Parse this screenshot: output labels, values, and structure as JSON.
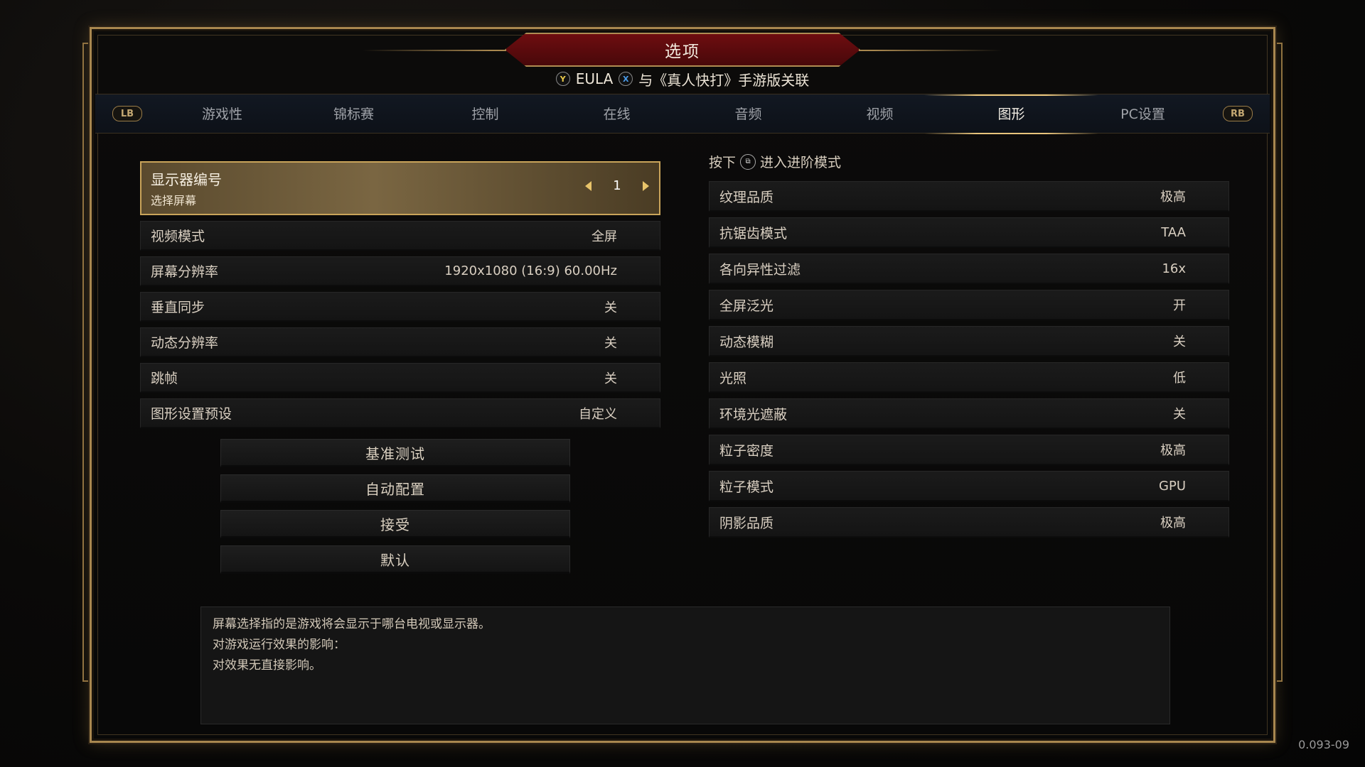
{
  "header": {
    "title": "选项",
    "eula_button": "Y",
    "eula_label": "EULA",
    "link_button": "X",
    "link_label": "与《真人快打》手游版关联"
  },
  "tabs": {
    "left_bumper": "LB",
    "right_bumper": "RB",
    "items": [
      {
        "label": "游戏性"
      },
      {
        "label": "锦标赛"
      },
      {
        "label": "控制"
      },
      {
        "label": "在线"
      },
      {
        "label": "音频"
      },
      {
        "label": "视频"
      },
      {
        "label": "图形",
        "active": true
      },
      {
        "label": "PC设置"
      }
    ]
  },
  "left_settings": {
    "selected": {
      "label": "显示器编号",
      "sublabel": "选择屏幕",
      "value": "1"
    },
    "rows": [
      {
        "label": "视频模式",
        "value": "全屏"
      },
      {
        "label": "屏幕分辨率",
        "value": "1920x1080 (16:9) 60.00Hz"
      },
      {
        "label": "垂直同步",
        "value": "关"
      },
      {
        "label": "动态分辨率",
        "value": "关"
      },
      {
        "label": "跳帧",
        "value": "关"
      },
      {
        "label": "图形设置预设",
        "value": "自定义"
      }
    ]
  },
  "action_buttons": [
    "基准测试",
    "自动配置",
    "接受",
    "默认"
  ],
  "advanced_hint": {
    "prefix": "按下",
    "suffix": "进入进阶模式"
  },
  "right_settings": {
    "rows": [
      {
        "label": "纹理品质",
        "value": "极高"
      },
      {
        "label": "抗锯齿模式",
        "value": "TAA"
      },
      {
        "label": "各向异性过滤",
        "value": "16x"
      },
      {
        "label": "全屏泛光",
        "value": "开"
      },
      {
        "label": "动态模糊",
        "value": "关"
      },
      {
        "label": "光照",
        "value": "低"
      },
      {
        "label": "环境光遮蔽",
        "value": "关"
      },
      {
        "label": "粒子密度",
        "value": "极高"
      },
      {
        "label": "粒子模式",
        "value": "GPU"
      },
      {
        "label": "阴影品质",
        "value": "极高"
      }
    ]
  },
  "description": {
    "line1": "屏幕选择指的是游戏将会显示于哪台电视或显示器。",
    "line2": "对游戏运行效果的影响：",
    "line3": "对效果无直接影响。"
  },
  "version": "0.093-09",
  "colors": {
    "accent_gold": "#c9a45a",
    "banner_red": "#6e0d10"
  }
}
